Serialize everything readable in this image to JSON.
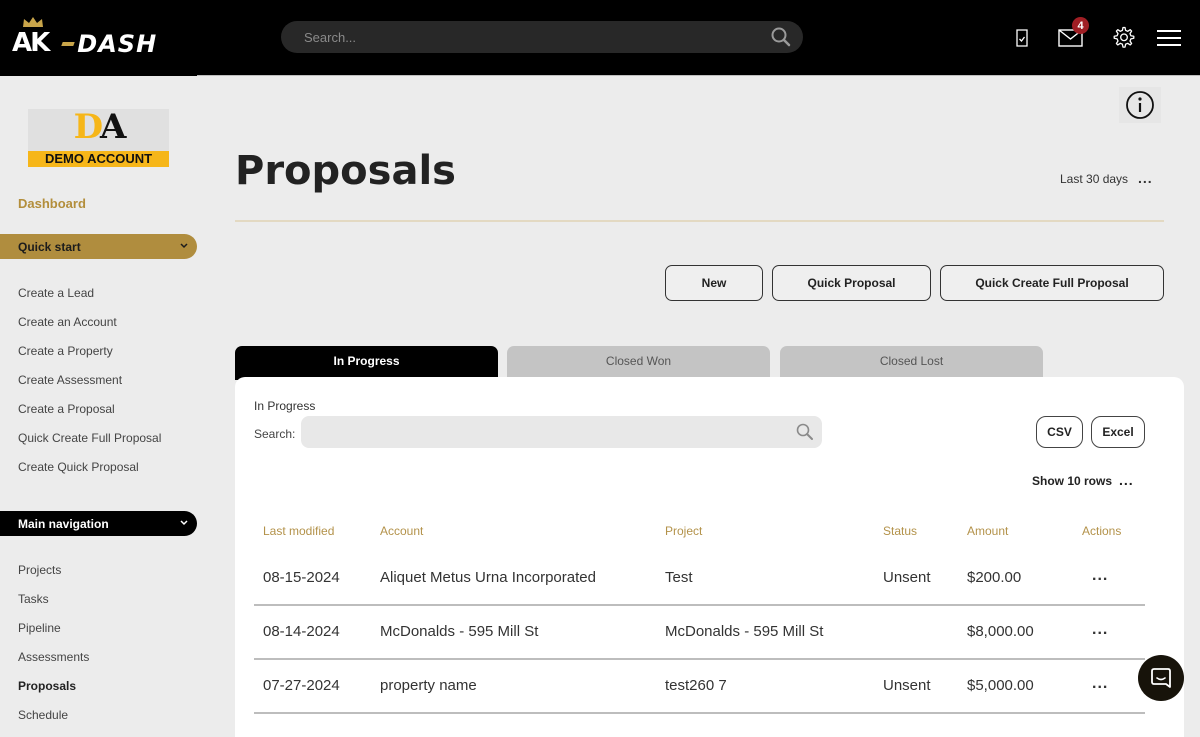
{
  "app": {
    "brand_left": "AK",
    "brand_right": "DASH"
  },
  "topbar": {
    "search_placeholder": "Search...",
    "icons": [
      "tasks-icon",
      "mail-icon",
      "gear-icon",
      "menu-icon"
    ],
    "mail_badge": "4"
  },
  "sidebar": {
    "account_logo_initials_d": "D",
    "account_logo_initials_a": "A",
    "account_logo_text": "DEMO ACCOUNT",
    "dashboard_label": "Dashboard",
    "quick_start": {
      "label": "Quick start",
      "items": [
        {
          "label": "Create a Lead"
        },
        {
          "label": "Create an Account"
        },
        {
          "label": "Create a Property"
        },
        {
          "label": "Create Assessment"
        },
        {
          "label": "Create a Proposal"
        },
        {
          "label": "Quick Create Full Proposal"
        },
        {
          "label": "Create Quick Proposal"
        }
      ]
    },
    "main_navigation": {
      "label": "Main navigation",
      "items": [
        {
          "label": "Projects",
          "active": false
        },
        {
          "label": "Tasks",
          "active": false
        },
        {
          "label": "Pipeline",
          "active": false
        },
        {
          "label": "Assessments",
          "active": false
        },
        {
          "label": "Proposals",
          "active": true
        },
        {
          "label": "Schedule",
          "active": false
        }
      ]
    }
  },
  "main": {
    "page_title": "Proposals",
    "date_range": "Last 30 days",
    "more_label": "...",
    "actions": {
      "new": "New",
      "quick_proposal": "Quick Proposal",
      "quick_create_full": "Quick Create Full Proposal"
    },
    "tabs": [
      {
        "label": "In Progress",
        "active": true
      },
      {
        "label": "Closed Won",
        "active": false
      },
      {
        "label": "Closed Lost",
        "active": false
      }
    ],
    "table_card": {
      "title": "In Progress",
      "search_label": "Search:",
      "search_value": "",
      "csv_label": "CSV",
      "excel_label": "Excel",
      "show_rows": "Show 10 rows",
      "columns": [
        "Last modified",
        "Account",
        "Project",
        "Status",
        "Amount",
        "Actions"
      ],
      "rows": [
        {
          "last_modified": "08-15-2024",
          "account": "Aliquet Metus Urna Incorporated",
          "project": "Test",
          "status": "Unsent",
          "amount": "$200.00",
          "actions": "..."
        },
        {
          "last_modified": "08-14-2024",
          "account": "McDonalds - 595 Mill St",
          "project": "McDonalds - 595 Mill St",
          "status": "",
          "amount": "$8,000.00",
          "actions": "..."
        },
        {
          "last_modified": "07-27-2024",
          "account": "property name",
          "project": "test260 7",
          "status": "Unsent",
          "amount": "$5,000.00",
          "actions": "..."
        }
      ]
    }
  },
  "colors": {
    "accent_gold": "#b08d3e",
    "header_gold": "#b3924a",
    "badge_red": "#a01e24",
    "logo_yellow": "#f6b619"
  }
}
